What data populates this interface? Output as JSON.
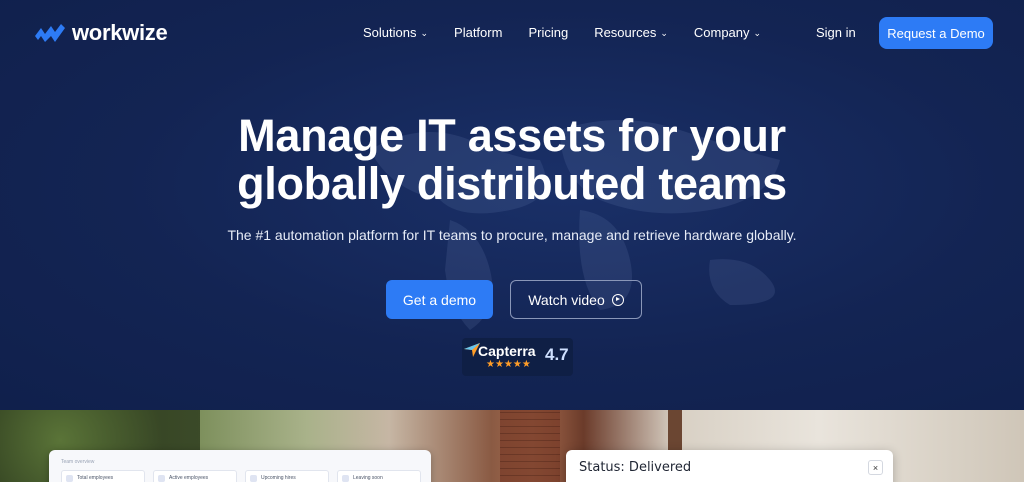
{
  "brand": {
    "name": "workwize",
    "accent": "#2d7bf5"
  },
  "nav": {
    "items": [
      {
        "label": "Solutions",
        "dropdown": true
      },
      {
        "label": "Platform",
        "dropdown": false
      },
      {
        "label": "Pricing",
        "dropdown": false
      },
      {
        "label": "Resources",
        "dropdown": true
      },
      {
        "label": "Company",
        "dropdown": true
      }
    ],
    "chevron": "⌄",
    "sign_in": "Sign in",
    "request_demo": "Request a Demo"
  },
  "hero": {
    "headline_line1": "Manage IT assets for your",
    "headline_line2": "globally distributed teams",
    "subline": "The #1 automation platform for IT teams to procure, manage and retrieve hardware globally.",
    "cta_primary": "Get a demo",
    "cta_secondary": "Watch video"
  },
  "capterra": {
    "name": "Capterra",
    "rating": "4.7",
    "stars": "★★★★★"
  },
  "dashboard": {
    "label": "Team overview",
    "cards": [
      "Total employees",
      "Active employees",
      "Upcoming hires",
      "Leaving soon"
    ]
  },
  "status_card": {
    "text": "Status: Delivered",
    "close": "×"
  }
}
